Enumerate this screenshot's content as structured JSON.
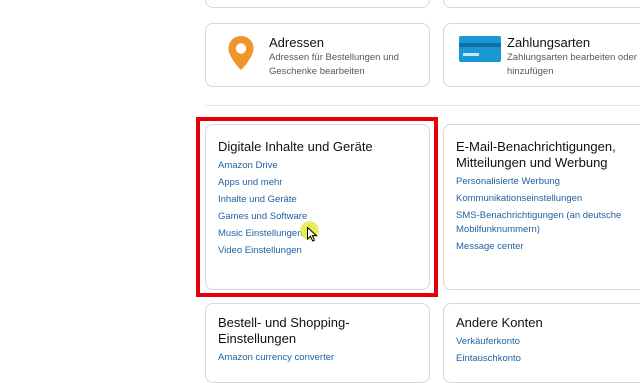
{
  "cards": {
    "adressen": {
      "title": "Adressen",
      "description": "Adressen für Bestellungen und Geschenke bearbeiten",
      "icon": "location-pin-icon",
      "icon_color": "#f0952b"
    },
    "zahlungsarten": {
      "title": "Zahlungsarten",
      "description": "Zahlungsarten bearbeiten oder hinzufügen",
      "icon": "credit-card-icon",
      "icon_color": "#1a98d5"
    },
    "digitale_inhalte": {
      "title": "Digitale Inhalte und Geräte",
      "links": [
        "Amazon Drive",
        "Apps und mehr",
        "Inhalte und Geräte",
        "Games und Software",
        "Music Einstellungen",
        "Video Einstellungen"
      ]
    },
    "email": {
      "title": "E-Mail-Benachrichtigungen, Mitteilungen und Werbung",
      "links": [
        "Personalisierte Werbung",
        "Kommunikationseinstellungen",
        "SMS-Benachrichtigungen (an deutsche Mobilfunknummern)",
        "Message center"
      ]
    },
    "bestell": {
      "title": "Bestell- und Shopping-Einstellungen",
      "links": [
        "Amazon currency converter"
      ]
    },
    "andere": {
      "title": "Andere Konten",
      "links": [
        "Verkäuferkonto",
        "Eintauschkonto"
      ]
    }
  },
  "colors": {
    "link": "#2162a1",
    "highlight_box": "#e3000b",
    "cursor_glow": "#ecec28"
  }
}
